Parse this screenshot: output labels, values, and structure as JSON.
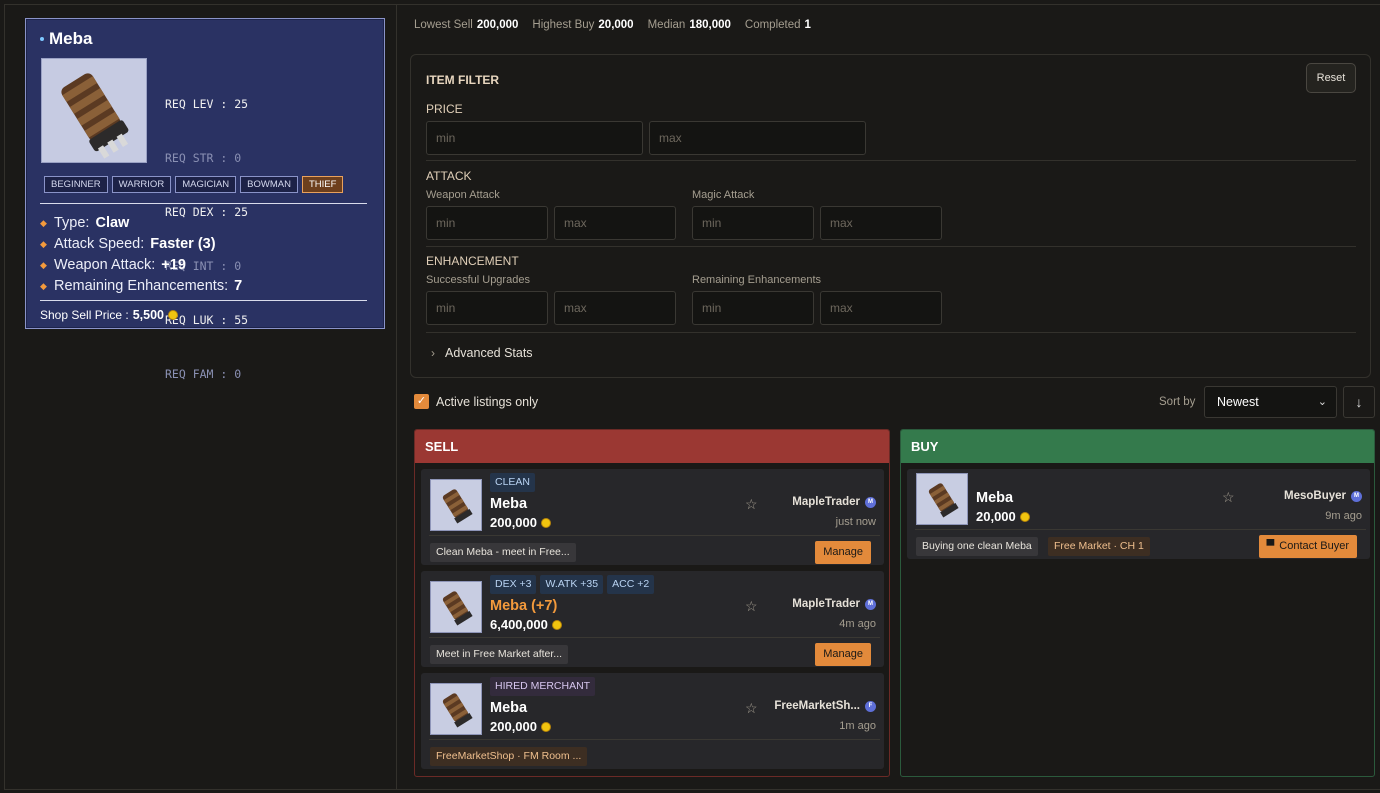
{
  "item_card": {
    "name": "Meba",
    "requirements": [
      {
        "label": "REQ LEV",
        "value": "25",
        "met": true
      },
      {
        "label": "REQ STR",
        "value": "0",
        "met": false
      },
      {
        "label": "REQ DEX",
        "value": "25",
        "met": true
      },
      {
        "label": "REQ INT",
        "value": "0",
        "met": false
      },
      {
        "label": "REQ LUK",
        "value": "55",
        "met": true
      },
      {
        "label": "REQ FAM",
        "value": "0",
        "met": false
      }
    ],
    "jobs": [
      "BEGINNER",
      "WARRIOR",
      "MAGICIAN",
      "BOWMAN",
      "THIEF"
    ],
    "active_job": "THIEF",
    "stats": [
      {
        "label": "Type:",
        "value": "Claw"
      },
      {
        "label": "Attack Speed:",
        "value": "Faster (3)"
      },
      {
        "label": "Weapon Attack:",
        "value": "+19"
      },
      {
        "label": "Remaining Enhancements:",
        "value": "7"
      }
    ],
    "shop_sell_label": "Shop Sell Price :",
    "shop_sell_value": "5,500"
  },
  "summary": {
    "lowest_sell_label": "Lowest Sell",
    "lowest_sell": "200,000",
    "highest_buy_label": "Highest Buy",
    "highest_buy": "20,000",
    "median_label": "Median",
    "median": "180,000",
    "completed_label": "Completed",
    "completed": "1"
  },
  "filter": {
    "title": "ITEM FILTER",
    "reset_label": "Reset",
    "price_label": "PRICE",
    "attack_label": "ATTACK",
    "weapon_attack_label": "Weapon Attack",
    "magic_attack_label": "Magic Attack",
    "enhancement_label": "ENHANCEMENT",
    "successful_upgrades_label": "Successful Upgrades",
    "remaining_enh_label": "Remaining Enhancements",
    "min_placeholder": "min",
    "max_placeholder": "max",
    "advanced_label": "Advanced Stats"
  },
  "controls": {
    "active_only_label": "Active listings only",
    "active_only_checked": true,
    "sort_label": "Sort by",
    "sort_value": "Newest"
  },
  "sell_panel": {
    "title": "SELL",
    "listings": [
      {
        "tags": [
          "CLEAN"
        ],
        "name": "Meba",
        "enhanced": false,
        "price": "200,000",
        "seller": "MapleTrader",
        "seller_badge": "M",
        "ago": "just now",
        "note": "Clean Meba - meet in Free...",
        "action": "Manage"
      },
      {
        "tags": [
          "DEX +3",
          "W.ATK +35",
          "ACC +2"
        ],
        "name": "Meba (+7)",
        "enhanced": true,
        "price": "6,400,000",
        "seller": "MapleTrader",
        "seller_badge": "M",
        "ago": "4m ago",
        "note": "Meet in Free Market after...",
        "action": "Manage"
      },
      {
        "tags": [
          "HIRED MERCHANT"
        ],
        "name": "Meba",
        "enhanced": false,
        "price": "200,000",
        "seller": "FreeMarketSh...",
        "seller_badge": "F",
        "ago": "1m ago",
        "note": "FreeMarketShop · FM Room ...",
        "action": ""
      }
    ]
  },
  "buy_panel": {
    "title": "BUY",
    "listings": [
      {
        "name": "Meba",
        "price": "20,000",
        "buyer": "MesoBuyer",
        "buyer_badge": "M",
        "ago": "9m ago",
        "note": "Buying one clean Meba",
        "location": "Free Market · CH 1",
        "action": "Contact Buyer"
      }
    ]
  },
  "colors": {
    "accent": "#e38a3b",
    "sell_header": "#9b3833",
    "buy_header": "#347a4c",
    "card_bg": "#2a3263"
  },
  "icons": {
    "item": "claw-weapon-icon",
    "star": "star-outline-icon",
    "coin": "meso-coin-icon",
    "sort_dir": "arrow-down-icon",
    "chat": "chat-bubble-icon"
  }
}
